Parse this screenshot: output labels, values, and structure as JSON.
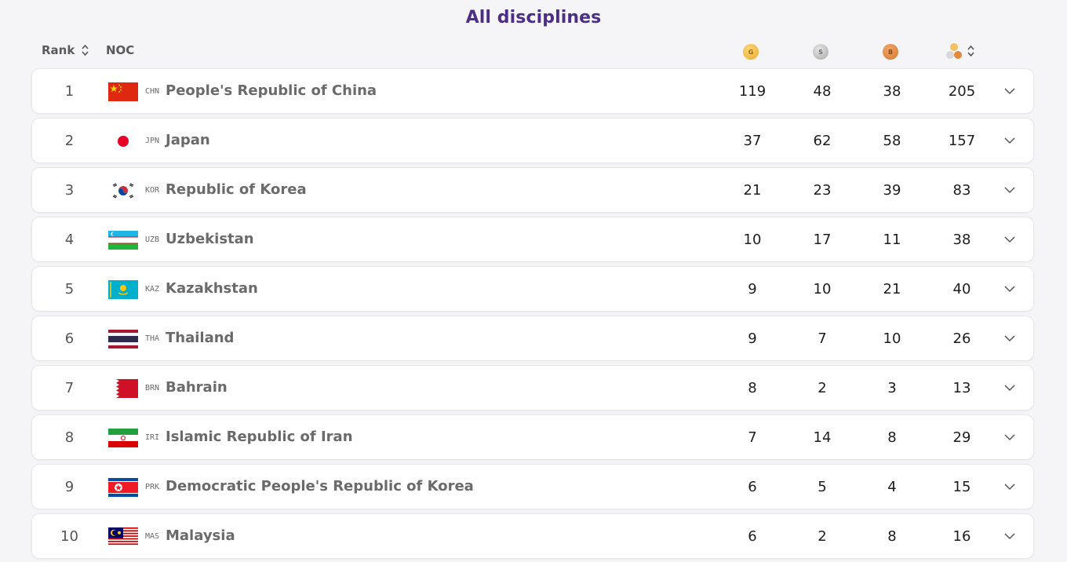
{
  "title": "All disciplines",
  "header": {
    "rank_label": "Rank",
    "noc_label": "NOC",
    "gold_letter": "G",
    "silver_letter": "S",
    "bronze_letter": "B"
  },
  "icons": {
    "sort": "sort-icon",
    "expand": "chevron-down-icon",
    "total": "medals-stack-icon"
  },
  "colors": {
    "title": "#4b2f86",
    "gold": "#e9a92c",
    "silver": "#a8a8a8",
    "bronze": "#d2762f"
  },
  "rows": [
    {
      "rank": "1",
      "code": "CHN",
      "name": "People's Republic of China",
      "gold": "119",
      "silver": "48",
      "bronze": "38",
      "total": "205",
      "flag": "chn"
    },
    {
      "rank": "2",
      "code": "JPN",
      "name": "Japan",
      "gold": "37",
      "silver": "62",
      "bronze": "58",
      "total": "157",
      "flag": "jpn"
    },
    {
      "rank": "3",
      "code": "KOR",
      "name": "Republic of Korea",
      "gold": "21",
      "silver": "23",
      "bronze": "39",
      "total": "83",
      "flag": "kor"
    },
    {
      "rank": "4",
      "code": "UZB",
      "name": "Uzbekistan",
      "gold": "10",
      "silver": "17",
      "bronze": "11",
      "total": "38",
      "flag": "uzb"
    },
    {
      "rank": "5",
      "code": "KAZ",
      "name": "Kazakhstan",
      "gold": "9",
      "silver": "10",
      "bronze": "21",
      "total": "40",
      "flag": "kaz"
    },
    {
      "rank": "6",
      "code": "THA",
      "name": "Thailand",
      "gold": "9",
      "silver": "7",
      "bronze": "10",
      "total": "26",
      "flag": "tha"
    },
    {
      "rank": "7",
      "code": "BRN",
      "name": "Bahrain",
      "gold": "8",
      "silver": "2",
      "bronze": "3",
      "total": "13",
      "flag": "brn"
    },
    {
      "rank": "8",
      "code": "IRI",
      "name": "Islamic Republic of Iran",
      "gold": "7",
      "silver": "14",
      "bronze": "8",
      "total": "29",
      "flag": "iri"
    },
    {
      "rank": "9",
      "code": "PRK",
      "name": "Democratic People's Republic of Korea",
      "gold": "6",
      "silver": "5",
      "bronze": "4",
      "total": "15",
      "flag": "prk"
    },
    {
      "rank": "10",
      "code": "MAS",
      "name": "Malaysia",
      "gold": "6",
      "silver": "2",
      "bronze": "8",
      "total": "16",
      "flag": "mas"
    }
  ]
}
